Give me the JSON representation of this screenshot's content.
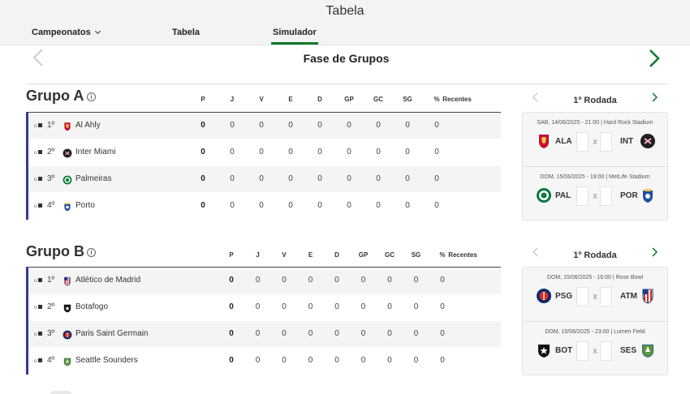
{
  "header": {
    "title": "Tabela"
  },
  "nav": {
    "campeonatos": "Campeonatos",
    "tabela": "Tabela",
    "simulador": "Simulador"
  },
  "phase": {
    "title": "Fase de Grupos"
  },
  "columns": [
    "P",
    "J",
    "V",
    "E",
    "D",
    "GP",
    "GC",
    "SG",
    "%",
    "Recentes"
  ],
  "groups": [
    {
      "title": "Grupo A",
      "rows": [
        {
          "pos": "1º",
          "team": "Al Ahly",
          "badge": "alahly",
          "stats": [
            "0",
            "0",
            "0",
            "0",
            "0",
            "0",
            "0",
            "0",
            "0"
          ]
        },
        {
          "pos": "2º",
          "team": "Inter Miami",
          "badge": "intermiami",
          "stats": [
            "0",
            "0",
            "0",
            "0",
            "0",
            "0",
            "0",
            "0",
            "0"
          ]
        },
        {
          "pos": "3º",
          "team": "Palmeiras",
          "badge": "palmeiras",
          "stats": [
            "0",
            "0",
            "0",
            "0",
            "0",
            "0",
            "0",
            "0",
            "0"
          ]
        },
        {
          "pos": "4º",
          "team": "Porto",
          "badge": "porto",
          "stats": [
            "0",
            "0",
            "0",
            "0",
            "0",
            "0",
            "0",
            "0",
            "0"
          ]
        }
      ],
      "round": {
        "title": "1º Rodada",
        "matches": [
          {
            "info": "SAB, 14/06/2025 - 21:00 | Hard Rock Stadium",
            "home": "ALA",
            "home_badge": "alahly",
            "away": "INT",
            "away_badge": "intermiami",
            "sep": "X"
          },
          {
            "info": "DOM, 15/06/2025 - 19:00 | MetLife Stadium",
            "home": "PAL",
            "home_badge": "palmeiras",
            "away": "POR",
            "away_badge": "porto",
            "sep": "X"
          }
        ]
      }
    },
    {
      "title": "Grupo B",
      "rows": [
        {
          "pos": "1º",
          "team": "Atlético de Madrid",
          "badge": "atletico",
          "stats": [
            "0",
            "0",
            "0",
            "0",
            "0",
            "0",
            "0",
            "0",
            "0"
          ]
        },
        {
          "pos": "2º",
          "team": "Botafogo",
          "badge": "botafogo",
          "stats": [
            "0",
            "0",
            "0",
            "0",
            "0",
            "0",
            "0",
            "0",
            "0"
          ]
        },
        {
          "pos": "3º",
          "team": "Paris Saint Germain",
          "badge": "psg",
          "stats": [
            "0",
            "0",
            "0",
            "0",
            "0",
            "0",
            "0",
            "0",
            "0"
          ]
        },
        {
          "pos": "4º",
          "team": "Seattle Sounders",
          "badge": "seattle",
          "stats": [
            "0",
            "0",
            "0",
            "0",
            "0",
            "0",
            "0",
            "0",
            "0"
          ]
        }
      ],
      "round": {
        "title": "1º Rodada",
        "matches": [
          {
            "info": "DOM, 15/06/2025 - 16:00 | Rose Bowl",
            "home": "PSG",
            "home_badge": "psg",
            "away": "ATM",
            "away_badge": "atletico",
            "sep": "X"
          },
          {
            "info": "DOM, 15/06/2025 - 23:00 | Lumen Field",
            "home": "BOT",
            "home_badge": "botafogo",
            "away": "SES",
            "away_badge": "seattle",
            "sep": "X"
          }
        ]
      }
    }
  ],
  "colors": {
    "accent_green": "#0a7a2b",
    "group_bar": "#343a9a",
    "row_alt": "#f4f4f4"
  }
}
